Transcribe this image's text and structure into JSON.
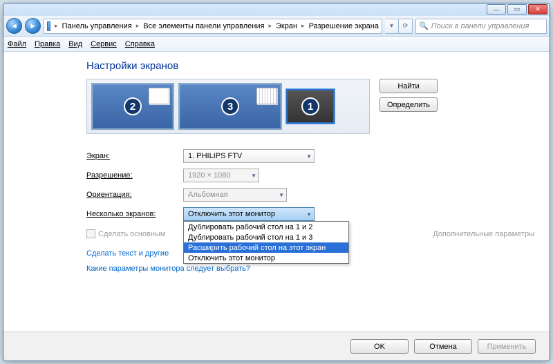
{
  "titlebar": {
    "minimize": "—",
    "maximize": "▭",
    "close": "✕"
  },
  "navbar": {
    "back": "◄",
    "forward": "►",
    "crumbs": [
      "Панель управления",
      "Все элементы панели управления",
      "Экран",
      "Разрешение экрана"
    ],
    "refresh": "⟳",
    "dropdown": "▾",
    "search_placeholder": "Поиск в панели управления",
    "search_icon": "🔍"
  },
  "menubar": {
    "file": "Файл",
    "edit": "Правка",
    "view": "Вид",
    "service": "Сервис",
    "help": "Справка"
  },
  "page": {
    "title": "Настройки экранов",
    "monitors": {
      "m1": "1",
      "m2": "2",
      "m3": "3"
    },
    "btn_find": "Найти",
    "btn_detect": "Определить"
  },
  "form": {
    "screen_label": "Экран:",
    "screen_value": "1. PHILIPS FTV",
    "res_label": "Разрешение:",
    "res_value": "1920 × 1080",
    "orient_label": "Ориентация:",
    "orient_value": "Альбомная",
    "multi_label": "Несколько экранов:",
    "multi_value": "Отключить этот монитор",
    "dropdown_items": [
      "Дублировать рабочий стол на 1 и 2",
      "Дублировать рабочий стол на 1 и 3",
      "Расширить рабочий стол на этот экран",
      "Отключить этот монитор"
    ],
    "chk_label": "Сделать основным",
    "advanced": "Дополнительные параметры"
  },
  "links": {
    "l1": "Сделать текст и другие",
    "l2": "Какие параметры монитора следует выбрать?"
  },
  "buttons": {
    "ok": "OK",
    "cancel": "Отмена",
    "apply": "Применить"
  }
}
